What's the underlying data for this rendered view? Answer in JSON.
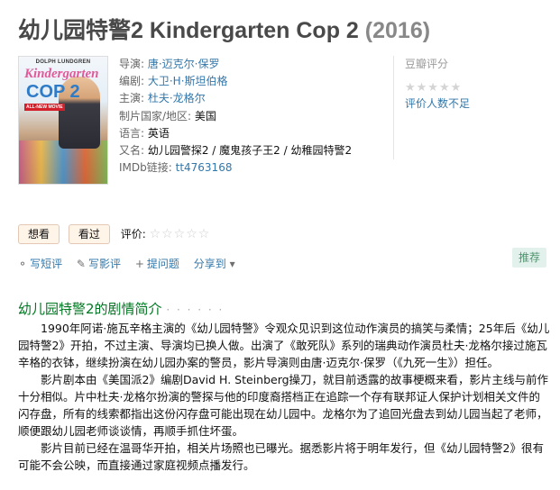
{
  "movie": {
    "title": "幼儿园特警2 Kindergarten Cop 2",
    "year": "(2016)"
  },
  "poster": {
    "top_text": "DOLPH LUNDGREN",
    "title_top": "Kindergarten",
    "title_bottom": "COP 2",
    "badge": "ALL-NEW MOVIE"
  },
  "info": {
    "director_label": "导演: ",
    "director": "唐·迈克尔·保罗",
    "writer_label": "编剧: ",
    "writer": "大卫·H·斯坦伯格",
    "cast_label": "主演: ",
    "cast": "杜夫·龙格尔",
    "country_label": "制片国家/地区: ",
    "country": "美国",
    "language_label": "语言: ",
    "language": "英语",
    "aka_label": "又名: ",
    "aka": "幼儿园警探2 / 魔鬼孩子王2 / 幼稚园特警2",
    "imdb_label": "IMDb链接: ",
    "imdb": "tt4763168"
  },
  "rating": {
    "title": "豆瓣评分",
    "stars": "★★★★★",
    "none_text": "评价人数不足"
  },
  "actions": {
    "want_label": "想看",
    "seen_label": "看过",
    "rate_label": "评价:",
    "rate_stars": "☆☆☆☆☆"
  },
  "tools": {
    "short_review": "写短评",
    "review": "写影评",
    "ask": "提问题",
    "share": "分享到",
    "recommend": "推荐",
    "icons": [
      "comment-icon",
      "pencil-icon",
      "plus-icon",
      "dropdown-icon"
    ]
  },
  "synopsis": {
    "heading": "幼儿园特警2的剧情简介",
    "dots": "· · · · · ·",
    "paragraphs": [
      "1990年阿诺·施瓦辛格主演的《幼儿园特警》令观众见识到这位动作演员的搞笑与柔情；25年后《幼儿园特警2》开拍，不过主演、导演均已换人做。出演了《敢死队》系列的瑞典动作演员杜夫·龙格尔接过施瓦辛格的衣钵，继续扮演在幼儿园办案的警员，影片导演则由唐·迈克尔·保罗（《九死一生》）担任。",
      "影片剧本由《美国派2》编剧David H. Steinberg操刀，就目前透露的故事梗概来看，影片主线与前作十分相似。片中杜夫·龙格尔扮演的警探与他的印度裔搭档正在追踪一个存有联邦证人保护计划相关文件的闪存盘，所有的线索都指出这份闪存盘可能出现在幼儿园中。龙格尔为了追回光盘去到幼儿园当起了老师，顺便跟幼儿园老师谈谈情，再顺手抓住坏蛋。",
      "影片目前已经在温哥华开拍，相关片场照也已曝光。据悉影片将于明年发行，但《幼儿园特警2》很有可能不会公映，而直接通过家庭视频点播发行。"
    ]
  }
}
